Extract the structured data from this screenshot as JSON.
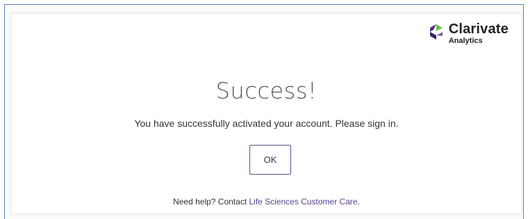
{
  "brand": {
    "name": "Clarivate",
    "sub": "Analytics",
    "icon": "clarivate-logo-icon",
    "colors": {
      "purple": "#5b2d86",
      "green": "#6fbf44",
      "dark": "#3d1f66"
    }
  },
  "dialog": {
    "title": "Success!",
    "message": "You have successfully activated your account. Please sign in.",
    "ok_label": "OK"
  },
  "help": {
    "prefix": "Need help? Contact ",
    "link_label": "Life Sciences Customer Care",
    "suffix": "."
  },
  "colors": {
    "frame_border": "#5b83b8",
    "link": "#5a3f8c",
    "button_border": "#5a4d7a"
  }
}
